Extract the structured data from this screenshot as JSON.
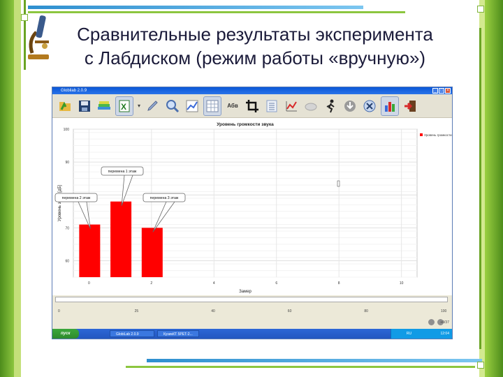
{
  "slide": {
    "title_line1": "Сравнительные результаты эксперимента",
    "title_line2": "с Лабдиском (режим работы «вручную»)"
  },
  "window": {
    "title": "Globilab 2.0.9"
  },
  "toolbar": {
    "icons": [
      "open-icon",
      "save-icon",
      "books-icon",
      "excel-icon",
      "dropdown-icon",
      "pen-icon",
      "zoom-icon",
      "graph-icon",
      "table-icon",
      "text-icon",
      "crop-icon",
      "list-icon",
      "analysis-icon",
      "eraser-icon",
      "runner-icon",
      "download-icon",
      "dna-icon",
      "bar-chart-icon",
      "exit-icon"
    ],
    "text_button": "Абв"
  },
  "chart_data": {
    "type": "bar",
    "title": "Уровень громкости звука",
    "xlabel": "Замер",
    "ylabel": "Уровень звука [дБ]",
    "x": [
      0,
      1,
      2
    ],
    "values": [
      71,
      78,
      70
    ],
    "series": [
      {
        "name": "Уровень громкости звука",
        "values": [
          71,
          78,
          70
        ]
      }
    ],
    "xlim": [
      -0.5,
      10.5
    ],
    "ylim": [
      55,
      100
    ],
    "xticks": [
      0,
      2,
      4,
      6,
      8,
      10
    ],
    "yticks": [
      60,
      70,
      80,
      90,
      100
    ],
    "bar_color": "#ff0000",
    "grid": true,
    "legend": "top-right",
    "annotations": [
      {
        "text": "перемена 2 этаж",
        "x": 0
      },
      {
        "text": "перемена 1 этаж",
        "x": 1
      },
      {
        "text": "перемена 3 этаж",
        "x": 2
      }
    ]
  },
  "timeline": {
    "ticks": [
      "0",
      "25",
      "40",
      "60",
      "80",
      "100"
    ],
    "right_label": "+0/37"
  },
  "taskbar": {
    "start_label": "пуск",
    "tasks": [
      "GlobiLab 2.0.9",
      "КузинКТ 5РЕТ-2..."
    ],
    "tray_lang": "RU",
    "tray_time": "12:04"
  },
  "colors": {
    "slide_green": "#6aa424",
    "title_color": "#1b1b3a",
    "window_blue": "#0a58d8",
    "bar_red": "#ff0000"
  }
}
